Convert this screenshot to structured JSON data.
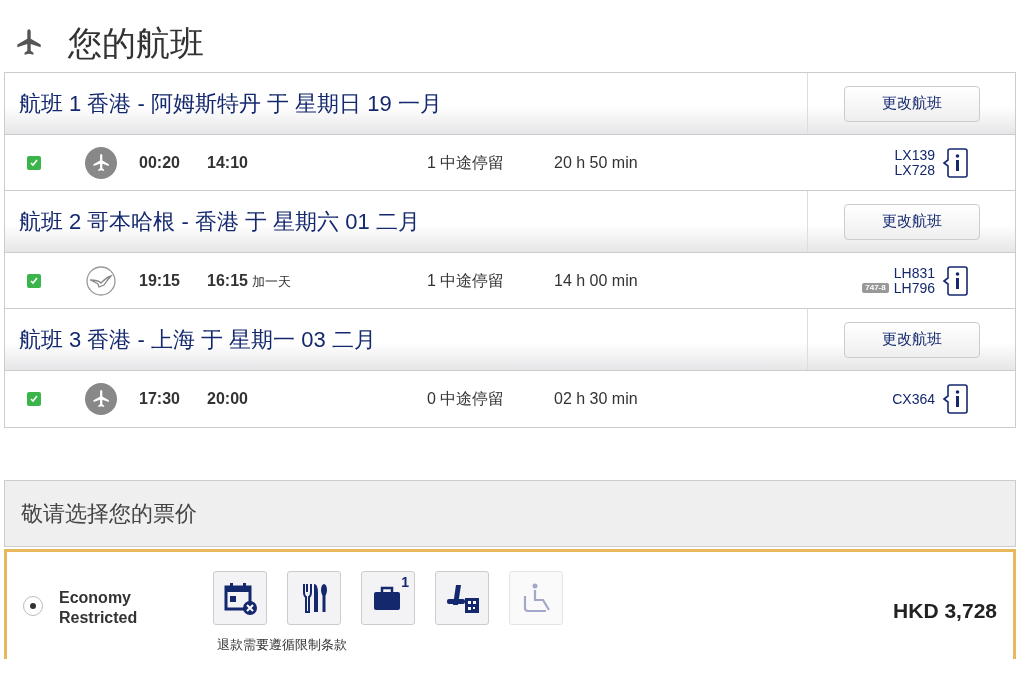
{
  "page_title": "您的航班",
  "flights": [
    {
      "heading": "航班 1 香港 - 阿姆斯特丹 于 星期日 19 一月",
      "change_button": "更改航班",
      "checked": true,
      "kind": "plane",
      "depart": "00:20",
      "arrive": "14:10",
      "stops": "1 中途停留",
      "duration": "20 h 50 min",
      "flight_numbers": [
        "LX139",
        "LX728"
      ]
    },
    {
      "heading": "航班 2 哥本哈根 - 香港 于 星期六 01 二月",
      "change_button": "更改航班",
      "checked": true,
      "kind": "crane",
      "depart": "19:15",
      "arrive": "16:15",
      "next_day": "加一天",
      "stops": "1 中途停留",
      "duration": "14 h 00 min",
      "flight_numbers": [
        "LH831",
        "LH796"
      ],
      "aircraft_badge": "747-8"
    },
    {
      "heading": "航班 3 香港 - 上海 于 星期一 03 二月",
      "change_button": "更改航班",
      "checked": true,
      "kind": "plane",
      "depart": "17:30",
      "arrive": "20:00",
      "stops": "0 中途停留",
      "duration": "02 h 30 min",
      "flight_numbers": [
        "CX364"
      ]
    }
  ],
  "fare_section": {
    "heading": "敬请选择您的票价",
    "fares": [
      {
        "selected": true,
        "name": "Economy Restricted",
        "note": "退款需要遵循限制条款",
        "price": "HKD 3,728",
        "amenities": [
          {
            "kind": "refund",
            "disabled": false
          },
          {
            "kind": "meal",
            "disabled": false
          },
          {
            "kind": "bag",
            "disabled": false,
            "count": "1"
          },
          {
            "kind": "seat",
            "disabled": false
          },
          {
            "kind": "recline",
            "disabled": true
          }
        ]
      }
    ]
  }
}
